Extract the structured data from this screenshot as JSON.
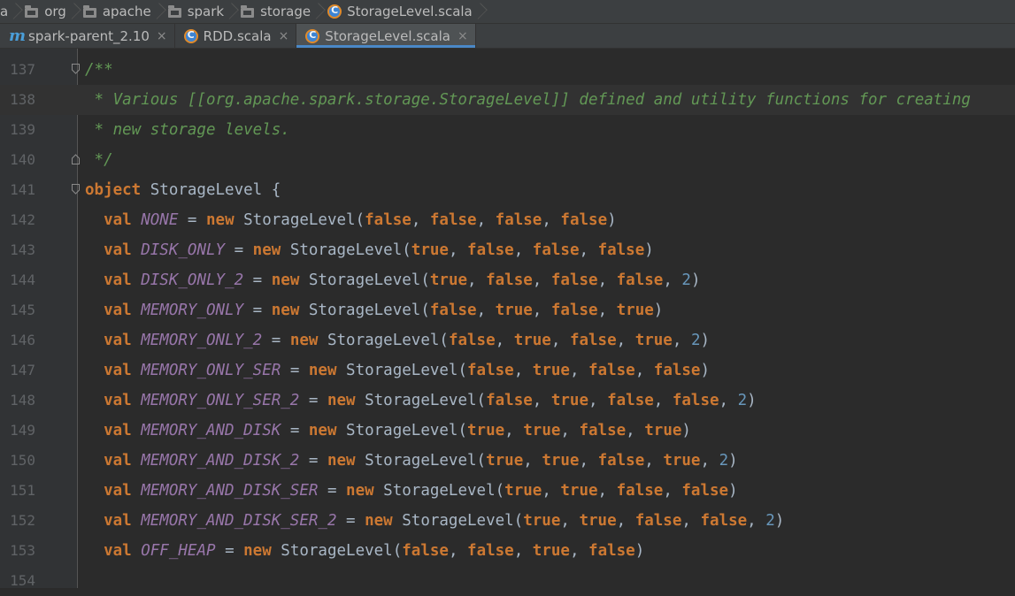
{
  "breadcrumb": {
    "leading": "a",
    "items": [
      "org",
      "apache",
      "spark",
      "storage"
    ],
    "file": "StorageLevel.scala"
  },
  "tabs": [
    {
      "label": "spark-parent_2.10",
      "icon": "maven-icon",
      "active": false
    },
    {
      "label": "RDD.scala",
      "icon": "scala-class-icon",
      "active": false
    },
    {
      "label": "StorageLevel.scala",
      "icon": "scala-class-icon",
      "active": true
    }
  ],
  "tab_close_glyph": "×",
  "editor": {
    "lines": [
      {
        "num": "137",
        "fold": "open",
        "tokens": [
          [
            "doc",
            "/**"
          ]
        ]
      },
      {
        "num": "138",
        "current": true,
        "tokens": [
          [
            "doc",
            " * Various [[org.apache.spark.storage.StorageLevel]] defined and utility functions for creating"
          ]
        ]
      },
      {
        "num": "139",
        "tokens": [
          [
            "doc",
            " * new storage levels."
          ]
        ]
      },
      {
        "num": "140",
        "fold": "end",
        "tokens": [
          [
            "doc",
            " */"
          ]
        ]
      },
      {
        "num": "141",
        "fold": "open",
        "tokens": [
          [
            "kw",
            "object"
          ],
          [
            "plain",
            " StorageLevel {"
          ]
        ]
      },
      {
        "num": "142",
        "tokens": [
          [
            "plain",
            "  "
          ],
          [
            "kw",
            "val"
          ],
          [
            "plain",
            " "
          ],
          [
            "const",
            "NONE"
          ],
          [
            "plain",
            " = "
          ],
          [
            "kw",
            "new"
          ],
          [
            "plain",
            " StorageLevel("
          ],
          [
            "kw",
            "false"
          ],
          [
            "plain",
            ", "
          ],
          [
            "kw",
            "false"
          ],
          [
            "plain",
            ", "
          ],
          [
            "kw",
            "false"
          ],
          [
            "plain",
            ", "
          ],
          [
            "kw",
            "false"
          ],
          [
            "plain",
            ")"
          ]
        ]
      },
      {
        "num": "143",
        "tokens": [
          [
            "plain",
            "  "
          ],
          [
            "kw",
            "val"
          ],
          [
            "plain",
            " "
          ],
          [
            "const",
            "DISK_ONLY"
          ],
          [
            "plain",
            " = "
          ],
          [
            "kw",
            "new"
          ],
          [
            "plain",
            " StorageLevel("
          ],
          [
            "kw",
            "true"
          ],
          [
            "plain",
            ", "
          ],
          [
            "kw",
            "false"
          ],
          [
            "plain",
            ", "
          ],
          [
            "kw",
            "false"
          ],
          [
            "plain",
            ", "
          ],
          [
            "kw",
            "false"
          ],
          [
            "plain",
            ")"
          ]
        ]
      },
      {
        "num": "144",
        "tokens": [
          [
            "plain",
            "  "
          ],
          [
            "kw",
            "val"
          ],
          [
            "plain",
            " "
          ],
          [
            "const",
            "DISK_ONLY_2"
          ],
          [
            "plain",
            " = "
          ],
          [
            "kw",
            "new"
          ],
          [
            "plain",
            " StorageLevel("
          ],
          [
            "kw",
            "true"
          ],
          [
            "plain",
            ", "
          ],
          [
            "kw",
            "false"
          ],
          [
            "plain",
            ", "
          ],
          [
            "kw",
            "false"
          ],
          [
            "plain",
            ", "
          ],
          [
            "kw",
            "false"
          ],
          [
            "plain",
            ", "
          ],
          [
            "num",
            "2"
          ],
          [
            "plain",
            ")"
          ]
        ]
      },
      {
        "num": "145",
        "tokens": [
          [
            "plain",
            "  "
          ],
          [
            "kw",
            "val"
          ],
          [
            "plain",
            " "
          ],
          [
            "const",
            "MEMORY_ONLY"
          ],
          [
            "plain",
            " = "
          ],
          [
            "kw",
            "new"
          ],
          [
            "plain",
            " StorageLevel("
          ],
          [
            "kw",
            "false"
          ],
          [
            "plain",
            ", "
          ],
          [
            "kw",
            "true"
          ],
          [
            "plain",
            ", "
          ],
          [
            "kw",
            "false"
          ],
          [
            "plain",
            ", "
          ],
          [
            "kw",
            "true"
          ],
          [
            "plain",
            ")"
          ]
        ]
      },
      {
        "num": "146",
        "tokens": [
          [
            "plain",
            "  "
          ],
          [
            "kw",
            "val"
          ],
          [
            "plain",
            " "
          ],
          [
            "const",
            "MEMORY_ONLY_2"
          ],
          [
            "plain",
            " = "
          ],
          [
            "kw",
            "new"
          ],
          [
            "plain",
            " StorageLevel("
          ],
          [
            "kw",
            "false"
          ],
          [
            "plain",
            ", "
          ],
          [
            "kw",
            "true"
          ],
          [
            "plain",
            ", "
          ],
          [
            "kw",
            "false"
          ],
          [
            "plain",
            ", "
          ],
          [
            "kw",
            "true"
          ],
          [
            "plain",
            ", "
          ],
          [
            "num",
            "2"
          ],
          [
            "plain",
            ")"
          ]
        ]
      },
      {
        "num": "147",
        "tokens": [
          [
            "plain",
            "  "
          ],
          [
            "kw",
            "val"
          ],
          [
            "plain",
            " "
          ],
          [
            "const",
            "MEMORY_ONLY_SER"
          ],
          [
            "plain",
            " = "
          ],
          [
            "kw",
            "new"
          ],
          [
            "plain",
            " StorageLevel("
          ],
          [
            "kw",
            "false"
          ],
          [
            "plain",
            ", "
          ],
          [
            "kw",
            "true"
          ],
          [
            "plain",
            ", "
          ],
          [
            "kw",
            "false"
          ],
          [
            "plain",
            ", "
          ],
          [
            "kw",
            "false"
          ],
          [
            "plain",
            ")"
          ]
        ]
      },
      {
        "num": "148",
        "tokens": [
          [
            "plain",
            "  "
          ],
          [
            "kw",
            "val"
          ],
          [
            "plain",
            " "
          ],
          [
            "const",
            "MEMORY_ONLY_SER_2"
          ],
          [
            "plain",
            " = "
          ],
          [
            "kw",
            "new"
          ],
          [
            "plain",
            " StorageLevel("
          ],
          [
            "kw",
            "false"
          ],
          [
            "plain",
            ", "
          ],
          [
            "kw",
            "true"
          ],
          [
            "plain",
            ", "
          ],
          [
            "kw",
            "false"
          ],
          [
            "plain",
            ", "
          ],
          [
            "kw",
            "false"
          ],
          [
            "plain",
            ", "
          ],
          [
            "num",
            "2"
          ],
          [
            "plain",
            ")"
          ]
        ]
      },
      {
        "num": "149",
        "tokens": [
          [
            "plain",
            "  "
          ],
          [
            "kw",
            "val"
          ],
          [
            "plain",
            " "
          ],
          [
            "const",
            "MEMORY_AND_DISK"
          ],
          [
            "plain",
            " = "
          ],
          [
            "kw",
            "new"
          ],
          [
            "plain",
            " StorageLevel("
          ],
          [
            "kw",
            "true"
          ],
          [
            "plain",
            ", "
          ],
          [
            "kw",
            "true"
          ],
          [
            "plain",
            ", "
          ],
          [
            "kw",
            "false"
          ],
          [
            "plain",
            ", "
          ],
          [
            "kw",
            "true"
          ],
          [
            "plain",
            ")"
          ]
        ]
      },
      {
        "num": "150",
        "tokens": [
          [
            "plain",
            "  "
          ],
          [
            "kw",
            "val"
          ],
          [
            "plain",
            " "
          ],
          [
            "const",
            "MEMORY_AND_DISK_2"
          ],
          [
            "plain",
            " = "
          ],
          [
            "kw",
            "new"
          ],
          [
            "plain",
            " StorageLevel("
          ],
          [
            "kw",
            "true"
          ],
          [
            "plain",
            ", "
          ],
          [
            "kw",
            "true"
          ],
          [
            "plain",
            ", "
          ],
          [
            "kw",
            "false"
          ],
          [
            "plain",
            ", "
          ],
          [
            "kw",
            "true"
          ],
          [
            "plain",
            ", "
          ],
          [
            "num",
            "2"
          ],
          [
            "plain",
            ")"
          ]
        ]
      },
      {
        "num": "151",
        "tokens": [
          [
            "plain",
            "  "
          ],
          [
            "kw",
            "val"
          ],
          [
            "plain",
            " "
          ],
          [
            "const",
            "MEMORY_AND_DISK_SER"
          ],
          [
            "plain",
            " = "
          ],
          [
            "kw",
            "new"
          ],
          [
            "plain",
            " StorageLevel("
          ],
          [
            "kw",
            "true"
          ],
          [
            "plain",
            ", "
          ],
          [
            "kw",
            "true"
          ],
          [
            "plain",
            ", "
          ],
          [
            "kw",
            "false"
          ],
          [
            "plain",
            ", "
          ],
          [
            "kw",
            "false"
          ],
          [
            "plain",
            ")"
          ]
        ]
      },
      {
        "num": "152",
        "tokens": [
          [
            "plain",
            "  "
          ],
          [
            "kw",
            "val"
          ],
          [
            "plain",
            " "
          ],
          [
            "const",
            "MEMORY_AND_DISK_SER_2"
          ],
          [
            "plain",
            " = "
          ],
          [
            "kw",
            "new"
          ],
          [
            "plain",
            " StorageLevel("
          ],
          [
            "kw",
            "true"
          ],
          [
            "plain",
            ", "
          ],
          [
            "kw",
            "true"
          ],
          [
            "plain",
            ", "
          ],
          [
            "kw",
            "false"
          ],
          [
            "plain",
            ", "
          ],
          [
            "kw",
            "false"
          ],
          [
            "plain",
            ", "
          ],
          [
            "num",
            "2"
          ],
          [
            "plain",
            ")"
          ]
        ]
      },
      {
        "num": "153",
        "tokens": [
          [
            "plain",
            "  "
          ],
          [
            "kw",
            "val"
          ],
          [
            "plain",
            " "
          ],
          [
            "const",
            "OFF_HEAP"
          ],
          [
            "plain",
            " = "
          ],
          [
            "kw",
            "new"
          ],
          [
            "plain",
            " StorageLevel("
          ],
          [
            "kw",
            "false"
          ],
          [
            "plain",
            ", "
          ],
          [
            "kw",
            "false"
          ],
          [
            "plain",
            ", "
          ],
          [
            "kw",
            "true"
          ],
          [
            "plain",
            ", "
          ],
          [
            "kw",
            "false"
          ],
          [
            "plain",
            ")"
          ]
        ]
      },
      {
        "num": "154",
        "tokens": []
      }
    ]
  },
  "colors": {
    "background": "#2b2b2b",
    "keyword": "#cc7832",
    "constant": "#9876aa",
    "number": "#6897bb",
    "doc_comment": "#629755",
    "text": "#a9b7c6",
    "active_tab_underline": "#4a88c7"
  }
}
